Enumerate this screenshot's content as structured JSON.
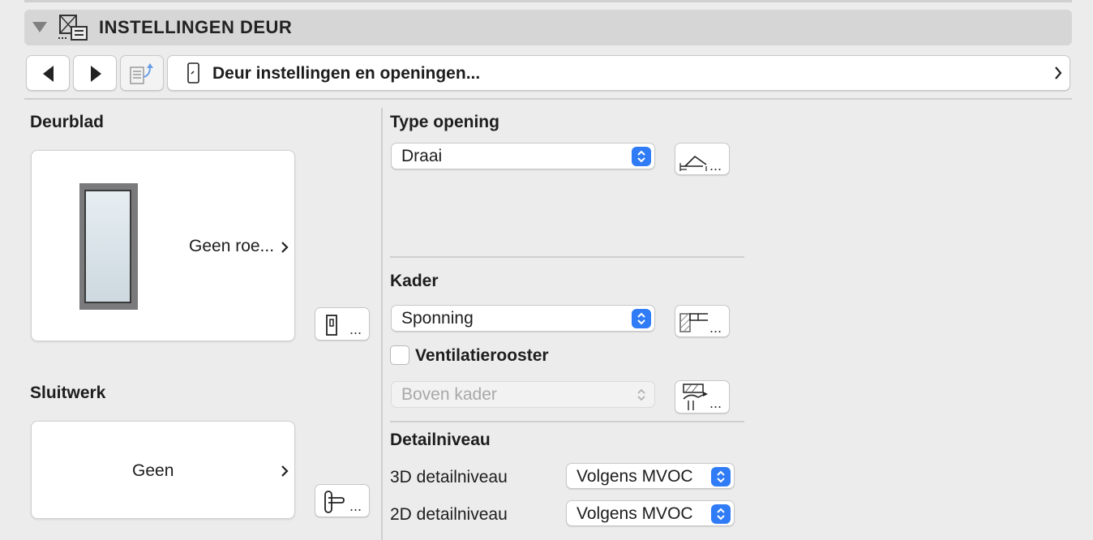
{
  "header": {
    "title": "INSTELLINGEN DEUR"
  },
  "nav": {
    "label": "Deur instellingen en openingen..."
  },
  "deurblad": {
    "title": "Deurblad",
    "card_label": "Geen roe..."
  },
  "sluitwerk": {
    "title": "Sluitwerk",
    "card_label": "Geen"
  },
  "type_opening": {
    "title": "Type opening",
    "selected": "Draai"
  },
  "kader": {
    "title": "Kader",
    "selected": "Sponning"
  },
  "ventilatie": {
    "label": "Ventilatierooster",
    "checked": false,
    "position_selected": "Boven kader"
  },
  "detail": {
    "title": "Detailniveau",
    "d3_label": "3D detailniveau",
    "d3_value": "Volgens MVOC",
    "d2_label": "2D detailniveau",
    "d2_value": "Volgens MVOC"
  },
  "more_label": "...",
  "colors": {
    "accent": "#2f7cf6",
    "background": "#ececec",
    "header": "#d6d6d6"
  }
}
